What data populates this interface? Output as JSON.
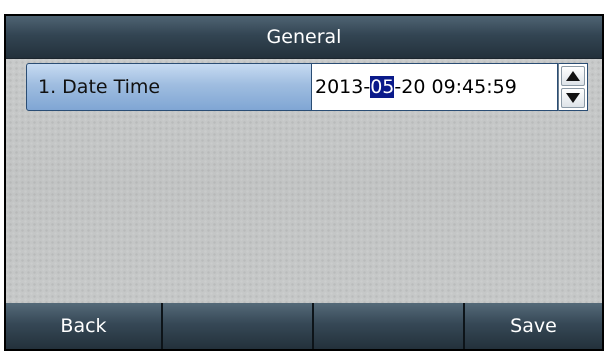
{
  "screen": {
    "title": "General"
  },
  "setting": {
    "label": "1. Date Time",
    "value_prefix": "2013-",
    "value_selected": "05",
    "value_suffix": "-20 09:45:59",
    "spinner_up_icon": "triangle-up-icon",
    "spinner_down_icon": "triangle-down-icon"
  },
  "softkeys": {
    "key1": "Back",
    "key2": "",
    "key3": "",
    "key4": "Save"
  },
  "colors": {
    "title_bar": "#334553",
    "row_highlight": "#9fbde0",
    "selection": "#0a1a8a"
  }
}
